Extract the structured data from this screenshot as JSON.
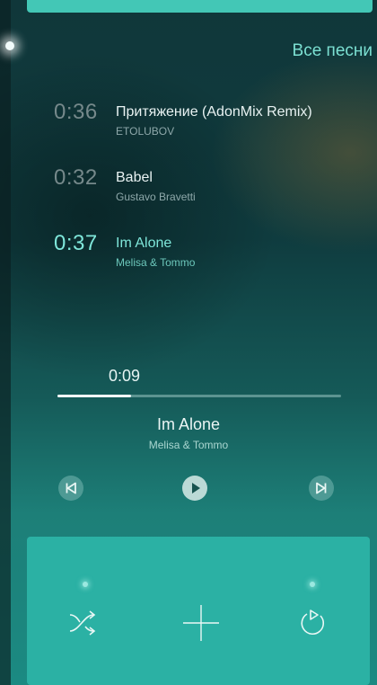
{
  "header": {
    "all_songs_label": "Все песни"
  },
  "playlist": [
    {
      "time": "0:36",
      "title": "Притяжение (AdonMix Remix)",
      "artist": "ETOLUBOV",
      "active": false
    },
    {
      "time": "0:32",
      "title": "Babel",
      "artist": "Gustavo Bravetti",
      "active": false
    },
    {
      "time": "0:37",
      "title": "Im Alone",
      "artist": "Melisa & Tommo",
      "active": true
    }
  ],
  "player": {
    "elapsed": "0:09",
    "progress_fraction": 0.26,
    "title": "Im Alone",
    "artist": "Melisa & Tommo"
  },
  "controls": {
    "previous_icon": "skip-previous-icon",
    "play_icon": "play-icon",
    "next_icon": "skip-next-icon"
  },
  "panel": {
    "shuffle_icon": "shuffle-icon",
    "add_icon": "plus-icon",
    "repeat_icon": "repeat-icon"
  },
  "colors": {
    "accent": "#43c7b6",
    "active_text": "#7fe7da",
    "panel": "#2bb1a4"
  }
}
